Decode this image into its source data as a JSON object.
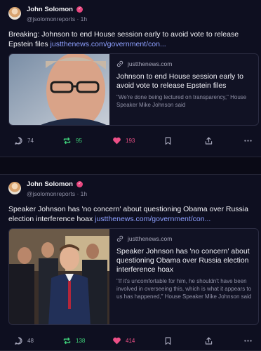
{
  "posts": [
    {
      "author": "John Solomon",
      "handle": "@jsolomonreports",
      "time": "1h",
      "text": "Breaking: Johnson to end House session early to avoid vote to release Epstein files ",
      "link": "justthenews.com/government/con...",
      "card": {
        "domain": "justthenews.com",
        "title": "Johnson to end House session early to avoid vote to release Epstein files",
        "description": "\"We're done being lectured on transparency,\" House Speaker Mike Johnson said"
      },
      "replies": "74",
      "reposts": "95",
      "likes": "193"
    },
    {
      "author": "John Solomon",
      "handle": "@jsolomonreports",
      "time": "1h",
      "text": "Speaker Johnson has 'no concern' about questioning Obama over Russia election interference hoax ",
      "link": "justthenews.com/government/con...",
      "card": {
        "domain": "justthenews.com",
        "title": "Speaker Johnson has 'no concern' about questioning Obama over Russia election interference hoax",
        "description": "\"If it's uncomfortable for him, he shouldn't have been involved in overseeing this, which is what it appears to us has happened,\" House Speaker Mike Johnson said"
      },
      "replies": "48",
      "reposts": "138",
      "likes": "414"
    }
  ],
  "colors": {
    "repost_green": "#3fd17a",
    "like_pink": "#ec4f86",
    "link_blue": "#8ea0ff",
    "icon_gray": "#a3a4b8"
  },
  "icons": [
    "reply-icon",
    "repost-icon",
    "heart-icon",
    "bookmark-icon",
    "share-icon",
    "more-icon",
    "link-icon",
    "verified-icon"
  ]
}
